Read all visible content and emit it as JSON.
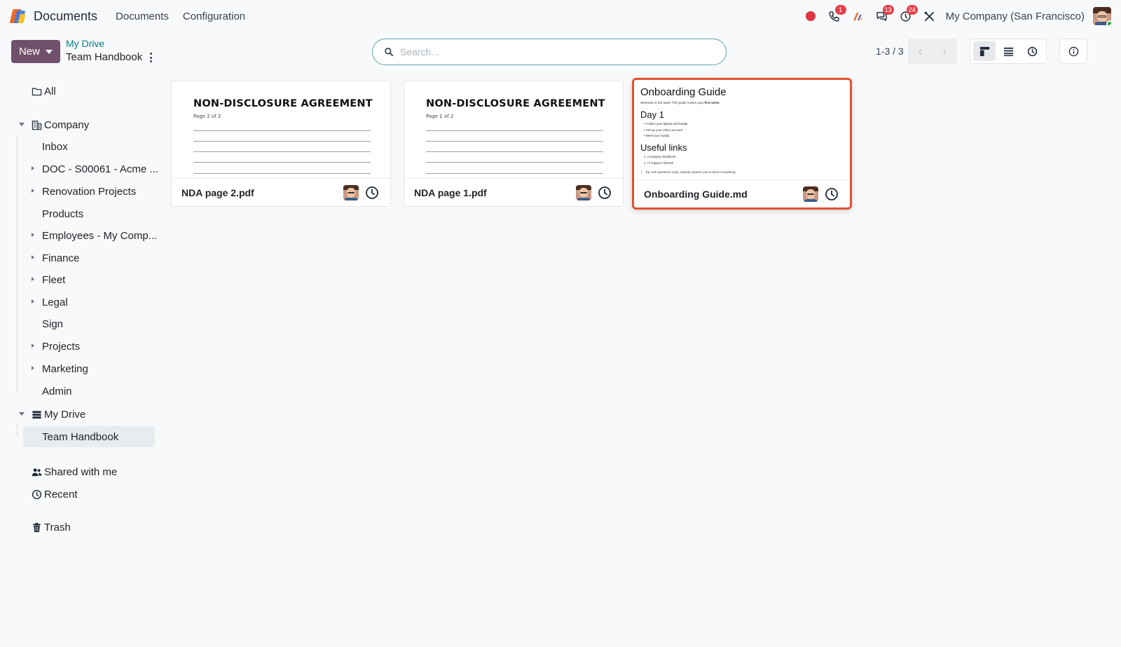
{
  "app": {
    "name": "Documents",
    "menu": [
      "Documents",
      "Configuration"
    ]
  },
  "systray": {
    "calls_badge": "1",
    "messages_badge": "13",
    "activities_badge": "24",
    "company": "My Company (San Francisco)",
    "accent_record": "#dc3545"
  },
  "control": {
    "new_label": "New",
    "breadcrumb_parent": "My Drive",
    "breadcrumb_current": "Team Handbook",
    "search_placeholder": "Search...",
    "search_value": "",
    "pager_value": "1-3 / 3",
    "active_view": "kanban"
  },
  "sidebar": {
    "all": "All",
    "company": "Company",
    "company_children": [
      {
        "label": "Inbox",
        "expandable": false
      },
      {
        "label": "DOC - S00061 - Acme ...",
        "expandable": true
      },
      {
        "label": "Renovation Projects",
        "expandable": true
      },
      {
        "label": "Products",
        "expandable": false
      },
      {
        "label": "Employees - My Comp...",
        "expandable": true
      },
      {
        "label": "Finance",
        "expandable": true
      },
      {
        "label": "Fleet",
        "expandable": true
      },
      {
        "label": "Legal",
        "expandable": true
      },
      {
        "label": "Sign",
        "expandable": false
      },
      {
        "label": "Projects",
        "expandable": true
      },
      {
        "label": "Marketing",
        "expandable": true
      },
      {
        "label": "Admin",
        "expandable": false
      }
    ],
    "my_drive": "My Drive",
    "my_drive_children": [
      {
        "label": "Team Handbook",
        "selected": true
      }
    ],
    "shared": "Shared with me",
    "recent": "Recent",
    "trash": "Trash"
  },
  "documents": [
    {
      "name": "NDA page 2.pdf",
      "preview_type": "pdf",
      "preview_title": "NON-DISCLOSURE AGREEMENT",
      "preview_page": "Page 2 of 2",
      "selected": false
    },
    {
      "name": "NDA page 1.pdf",
      "preview_type": "pdf",
      "preview_title": "NON-DISCLOSURE AGREEMENT",
      "preview_page": "Page 1 of 2",
      "selected": false
    },
    {
      "name": "Onboarding Guide.md",
      "preview_type": "markdown",
      "preview_title": "Onboarding Guide",
      "preview_intro": "Welcome to the team! This guide covers your",
      "preview_intro_bold": "first week.",
      "preview_section1": "Day 1",
      "preview_section1_items": [
        "Collect your laptop and badge",
        "Set up your Odoo account",
        "Meet your buddy"
      ],
      "preview_section2": "Useful links",
      "preview_section2_items": [
        "1. Company handbook",
        "2. IT support channel"
      ],
      "preview_tip": "Tip: ask questions early, nobody expects you to know everything.",
      "selected": true
    }
  ],
  "colors": {
    "primary": "#71506b",
    "link": "#017e84",
    "selection": "#e0532e",
    "badge": "#e4424d"
  }
}
